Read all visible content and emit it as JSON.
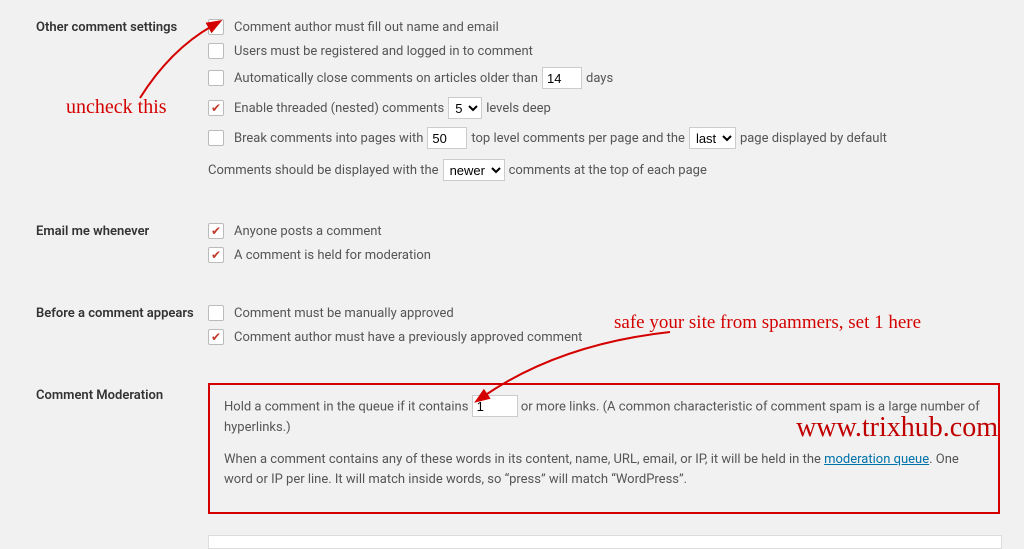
{
  "sections": {
    "other": {
      "heading": "Other comment settings",
      "opt1": "Comment author must fill out name and email",
      "opt2": "Users must be registered and logged in to comment",
      "opt3_pre": "Automatically close comments on articles older than",
      "opt3_days": "14",
      "opt3_post": "days",
      "opt4_pre": "Enable threaded (nested) comments",
      "opt4_levels": "5",
      "opt4_post": "levels deep",
      "opt5_pre": "Break comments into pages with",
      "opt5_perpage": "50",
      "opt5_mid": "top level comments per page and the",
      "opt5_lastfirst": "last",
      "opt5_post": "page displayed by default",
      "opt6_pre": "Comments should be displayed with the",
      "opt6_order": "newer",
      "opt6_post": "comments at the top of each page"
    },
    "email": {
      "heading": "Email me whenever",
      "opt1": "Anyone posts a comment",
      "opt2": "A comment is held for moderation"
    },
    "before": {
      "heading": "Before a comment appears",
      "opt1": "Comment must be manually approved",
      "opt2": "Comment author must have a previously approved comment"
    },
    "moderation": {
      "heading": "Comment Moderation",
      "p1_pre": "Hold a comment in the queue if it contains",
      "p1_links": "1",
      "p1_post": "or more links. (A common characteristic of comment spam is a large number of hyperlinks.)",
      "p2_pre": "When a comment contains any of these words in its content, name, URL, email, or IP, it will be held in the ",
      "p2_link": "moderation queue",
      "p2_post": ". One word or IP per line. It will match inside words, so “press” will match “WordPress”."
    }
  },
  "annotations": {
    "uncheck": "uncheck this",
    "safe": "safe your site from spammers, set 1 here",
    "brand": "www.trixhub.com"
  }
}
